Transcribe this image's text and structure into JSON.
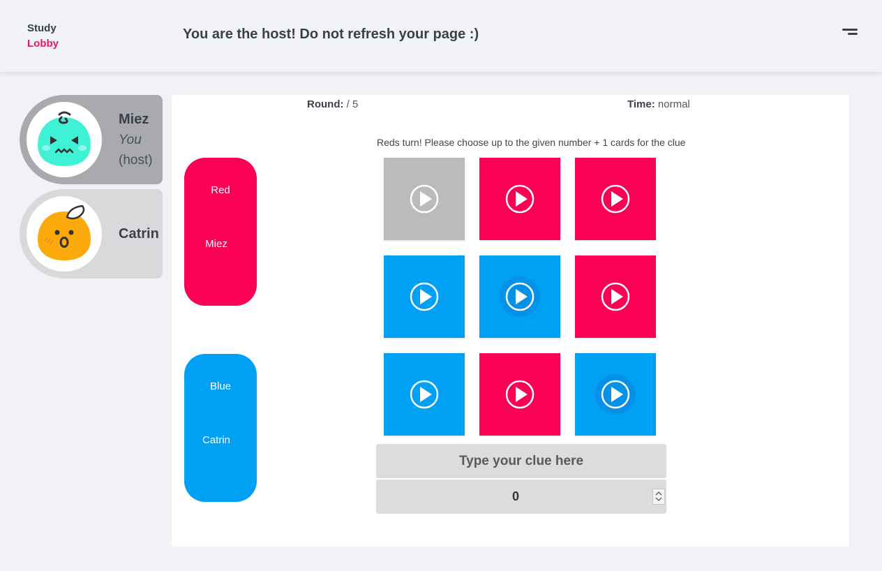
{
  "header": {
    "brand_line1": "Study",
    "brand_line2": "Lobby",
    "host_message": "You are the host! Do not refresh your page :)",
    "menu_icon": "hamburger-menu-icon"
  },
  "players": [
    {
      "name": "Miez",
      "you_label": "You",
      "host_label": "(host)",
      "avatar_color": "#3ff2d6",
      "avatar_icon": "angry-blob-avatar-icon"
    },
    {
      "name": "Catrin",
      "avatar_color": "#fba90b",
      "avatar_icon": "surprised-blob-avatar-icon"
    }
  ],
  "game": {
    "round_label": "Round:",
    "round_value": "/ 5",
    "time_label": "Time:",
    "time_value": "normal",
    "instruction": "Reds turn! Please choose up to the given number + 1 cards for the clue",
    "teams": [
      {
        "name": "Red",
        "member": "Miez",
        "color": "#fb0053"
      },
      {
        "name": "Blue",
        "member": "Catrin",
        "color": "#00a0f4"
      }
    ],
    "cards": [
      {
        "color": "gray"
      },
      {
        "color": "red"
      },
      {
        "color": "red"
      },
      {
        "color": "blue"
      },
      {
        "color": "blue",
        "highlighted": true
      },
      {
        "color": "red"
      },
      {
        "color": "blue"
      },
      {
        "color": "red"
      },
      {
        "color": "blue",
        "highlighted": true
      }
    ],
    "clue_placeholder": "Type your clue here",
    "number_value": "0"
  },
  "colors": {
    "red": "#fb0053",
    "blue": "#00a0f4",
    "gray": "#bbbbbb",
    "accent": "#e8175d"
  }
}
